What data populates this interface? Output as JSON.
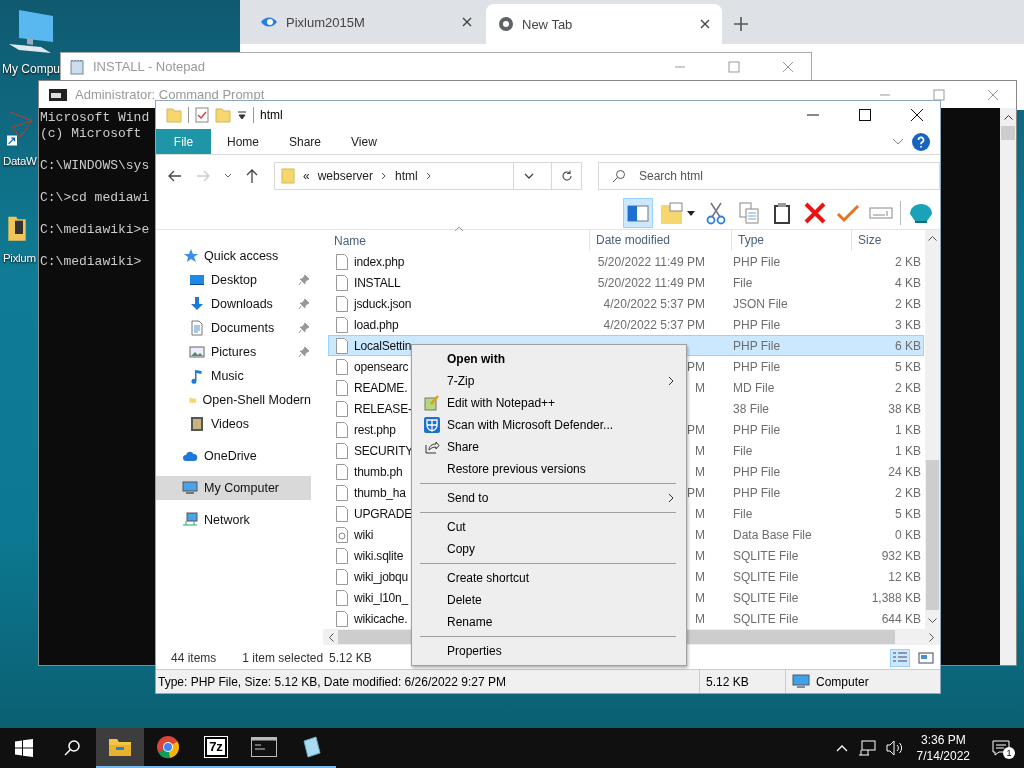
{
  "desktop": {
    "icons": [
      {
        "kind": "computer",
        "label": "My Compu"
      },
      {
        "kind": "shortcut",
        "label": "DataW"
      },
      {
        "kind": "folder",
        "label": "Pixlum"
      }
    ]
  },
  "browser": {
    "tabs": [
      {
        "title": "Pixlum2015M",
        "selected": false
      },
      {
        "title": "New Tab",
        "selected": true
      }
    ]
  },
  "notepad": {
    "title": "INSTALL - Notepad"
  },
  "command_prompt": {
    "title": "Administrator: Command Prompt",
    "blocks": [
      [
        "Microsoft Wind",
        "(c) Microsoft"
      ],
      [
        "C:\\WINDOWS\\sys"
      ],
      [
        "C:\\>cd mediawi"
      ],
      [
        "C:\\mediawiki>e"
      ],
      [
        "C:\\mediawiki>"
      ]
    ]
  },
  "explorer": {
    "title": "html",
    "ribbon_tabs": [
      {
        "label": "File",
        "selected": true
      },
      {
        "label": "Home",
        "selected": false
      },
      {
        "label": "Share",
        "selected": false
      },
      {
        "label": "View",
        "selected": false
      }
    ],
    "address": {
      "overflow": "«",
      "segments": [
        "webserver",
        "html"
      ]
    },
    "search": {
      "placeholder": "Search html"
    },
    "toolbar": [
      {
        "kind": "preview",
        "selected": true
      },
      {
        "kind": "folder",
        "selected": false
      },
      {
        "kind": "cut",
        "selected": false
      },
      {
        "kind": "copy",
        "selected": false
      },
      {
        "kind": "paste",
        "selected": false
      },
      {
        "kind": "delete",
        "selected": false
      },
      {
        "kind": "check",
        "selected": false
      },
      {
        "kind": "rename",
        "selected": false
      },
      {
        "kind": "shell",
        "selected": false
      }
    ],
    "nav": [
      {
        "label": "Quick access",
        "kind": "star",
        "selected": false,
        "children": [
          {
            "label": "Desktop",
            "kind": "desktop",
            "pinned": true,
            "selected": false
          },
          {
            "label": "Downloads",
            "kind": "download",
            "pinned": true,
            "selected": false
          },
          {
            "label": "Documents",
            "kind": "document",
            "pinned": true,
            "selected": false
          },
          {
            "label": "Pictures",
            "kind": "picture",
            "pinned": true,
            "selected": false
          },
          {
            "label": "Music",
            "kind": "music",
            "pinned": false,
            "selected": false
          },
          {
            "label": "Open-Shell Modern",
            "kind": "folder",
            "pinned": false,
            "selected": false
          },
          {
            "label": "Videos",
            "kind": "video",
            "pinned": false,
            "selected": false
          }
        ]
      },
      {
        "label": "OneDrive",
        "kind": "cloud",
        "selected": false
      },
      {
        "label": "My Computer",
        "kind": "computer",
        "selected": true
      },
      {
        "label": "Network",
        "kind": "network",
        "selected": false
      }
    ],
    "columns": [
      "Name",
      "Date modified",
      "Type",
      "Size"
    ],
    "files": [
      {
        "name": "index.php",
        "kind": "file",
        "date": "5/20/2022 11:49 PM",
        "type": "PHP File",
        "size": "2 KB",
        "selected": false
      },
      {
        "name": "INSTALL",
        "kind": "file",
        "date": "5/20/2022 11:49 PM",
        "type": "File",
        "size": "4 KB",
        "selected": false
      },
      {
        "name": "jsduck.json",
        "kind": "file",
        "date": "4/20/2022 5:37 PM",
        "type": "JSON File",
        "size": "2 KB",
        "selected": false
      },
      {
        "name": "load.php",
        "kind": "file",
        "date": "4/20/2022 5:37 PM",
        "type": "PHP File",
        "size": "3 KB",
        "selected": false
      },
      {
        "name": "LocalSettin",
        "kind": "file",
        "type": "PHP File",
        "size": "6 KB",
        "selected": true
      },
      {
        "name": "opensearc",
        "kind": "file",
        "date": "PM",
        "type": "PHP File",
        "size": "5 KB",
        "selected": false
      },
      {
        "name": "README.",
        "kind": "file",
        "date": "M",
        "type": "MD File",
        "size": "2 KB",
        "selected": false
      },
      {
        "name": "RELEASE-",
        "kind": "file",
        "type": "38 File",
        "size": "38 KB",
        "selected": false
      },
      {
        "name": "rest.php",
        "kind": "file",
        "date": "PM",
        "type": "PHP File",
        "size": "1 KB",
        "selected": false
      },
      {
        "name": "SECURITY",
        "kind": "file",
        "date": "M",
        "type": "File",
        "size": "1 KB",
        "selected": false
      },
      {
        "name": "thumb.ph",
        "kind": "file",
        "date": "M",
        "type": "PHP File",
        "size": "24 KB",
        "selected": false
      },
      {
        "name": "thumb_ha",
        "kind": "file",
        "date": "PM",
        "type": "PHP File",
        "size": "2 KB",
        "selected": false
      },
      {
        "name": "UPGRADE",
        "kind": "file",
        "date": "M",
        "type": "File",
        "size": "5 KB",
        "selected": false
      },
      {
        "name": "wiki",
        "kind": "database",
        "date": "M",
        "type": "Data Base File",
        "size": "0 KB",
        "selected": false
      },
      {
        "name": "wiki.sqlite",
        "kind": "file",
        "date": "M",
        "type": "SQLITE File",
        "size": "932 KB",
        "selected": false
      },
      {
        "name": "wiki_jobqu",
        "kind": "file",
        "date": "M",
        "type": "SQLITE File",
        "size": "12 KB",
        "selected": false
      },
      {
        "name": "wiki_l10n_",
        "kind": "file",
        "date": "M",
        "type": "SQLITE File",
        "size": "1,388 KB",
        "selected": false
      },
      {
        "name": "wikicache.",
        "kind": "file",
        "date": "M",
        "type": "SQLITE File",
        "size": "644 KB",
        "selected": false
      }
    ],
    "status": {
      "items": "44 items",
      "selection": "1 item selected",
      "size": "5.12 KB"
    },
    "views": [
      {
        "kind": "details",
        "selected": true
      },
      {
        "kind": "tiles",
        "selected": false
      }
    ],
    "status_bar": {
      "details": "Type: PHP File, Size: 5.12 KB, Date modified: 6/26/2022 9:27 PM",
      "size": "5.12 KB",
      "zone": "Computer"
    }
  },
  "context_menu": [
    {
      "kind": "default",
      "label": "Open with"
    },
    {
      "kind": "submenu",
      "label": "7-Zip"
    },
    {
      "kind": "notepad",
      "label": "Edit with Notepad++"
    },
    {
      "kind": "defender",
      "label": "Scan with Microsoft Defender..."
    },
    {
      "kind": "share",
      "label": "Share"
    },
    {
      "kind": "plain",
      "label": "Restore previous versions"
    },
    {
      "kind": "separator"
    },
    {
      "kind": "submenu",
      "label": "Send to"
    },
    {
      "kind": "separator"
    },
    {
      "kind": "plain",
      "label": "Cut"
    },
    {
      "kind": "plain",
      "label": "Copy"
    },
    {
      "kind": "separator"
    },
    {
      "kind": "plain",
      "label": "Create shortcut"
    },
    {
      "kind": "plain",
      "label": "Delete"
    },
    {
      "kind": "plain",
      "label": "Rename"
    },
    {
      "kind": "separator"
    },
    {
      "kind": "plain",
      "label": "Properties"
    }
  ],
  "taskbar": {
    "apps": [
      {
        "kind": "explorer",
        "selected": true
      },
      {
        "kind": "chrome",
        "selected": false
      },
      {
        "kind": "archiver",
        "label": "7z",
        "selected": false
      },
      {
        "kind": "terminal",
        "selected": false
      },
      {
        "kind": "notepad",
        "selected": false
      }
    ],
    "time": "3:36 PM",
    "date": "7/14/2022",
    "notifications": "1"
  }
}
